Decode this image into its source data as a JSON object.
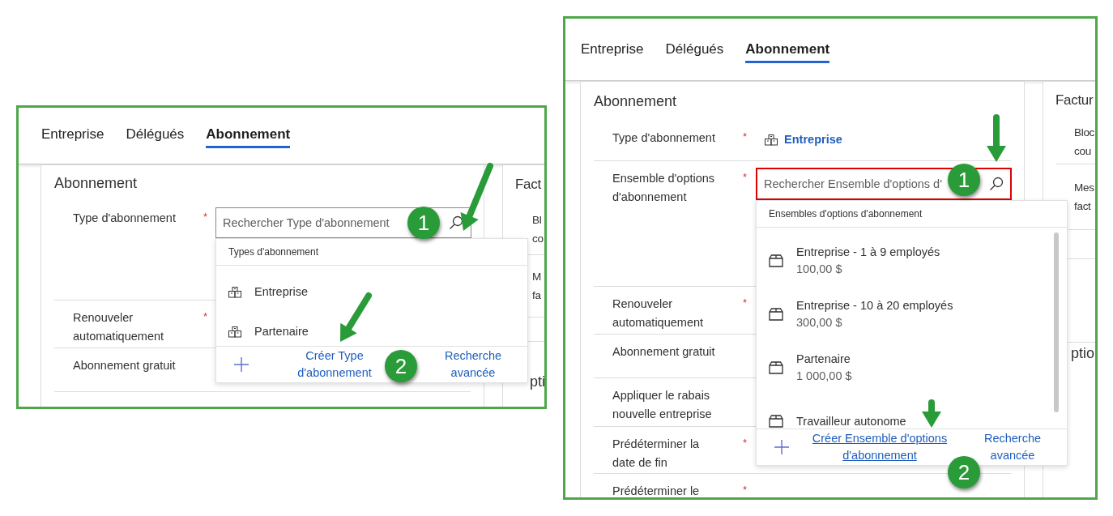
{
  "left_screenshot": {
    "tabs": [
      {
        "label": "Entreprise",
        "selected": false
      },
      {
        "label": "Délégués",
        "selected": false
      },
      {
        "label": "Abonnement",
        "selected": true
      }
    ],
    "form": {
      "title": "Abonnement",
      "fields": [
        {
          "label": "Type d'abonnement",
          "required_mark": "*"
        },
        {
          "label": "Renouveler automatiquement",
          "required_mark": "*"
        },
        {
          "label": "Abonnement gratuit"
        }
      ]
    },
    "side_section": {
      "title": "Fact",
      "rows": [
        [
          "Bl",
          "co"
        ],
        [
          "M",
          "fa"
        ]
      ],
      "next_title": "pti"
    },
    "lookup": {
      "placeholder": "Rechercher Type d'abonnement",
      "focused": false,
      "header": "Types d'abonnement",
      "items": [
        {
          "kind": "boxes",
          "name": "Entreprise"
        },
        {
          "kind": "boxes",
          "name": "Partenaire"
        }
      ],
      "create_link": {
        "text": "Créer Type d'abonnement",
        "hovered": false
      },
      "advanced_link": "Recherche avancée"
    },
    "callouts": [
      "1",
      "2"
    ]
  },
  "right_screenshot": {
    "tabs": [
      {
        "label": "Entreprise",
        "selected": false
      },
      {
        "label": "Délégués",
        "selected": false
      },
      {
        "label": "Abonnement",
        "selected": true
      }
    ],
    "form": {
      "title": "Abonnement",
      "fields": [
        {
          "label": "Type d'abonnement",
          "required_mark": "*",
          "value": "Entreprise"
        },
        {
          "label": "Ensemble d'options d'abonnement",
          "required_mark": "*"
        },
        {
          "label": "Renouveler automatiquement",
          "required_mark": "*"
        },
        {
          "label": "Abonnement gratuit"
        },
        {
          "label": "Appliquer le rabais nouvelle entreprise"
        },
        {
          "label": "Prédéterminer la date de fin",
          "required_mark": "*"
        },
        {
          "label": "Prédéterminer le",
          "required_mark": "*"
        }
      ]
    },
    "side_section": {
      "title": "Factur",
      "rows": [
        [
          "Bloc",
          "cou"
        ],
        [
          "Mes",
          "fact"
        ]
      ],
      "next_title": "ptio"
    },
    "lookup": {
      "placeholder": "Rechercher Ensemble d'options d'",
      "focused": true,
      "header": "Ensembles d'options d'abonnement",
      "items": [
        {
          "kind": "package",
          "name": "Entreprise - 1 à 9 employés",
          "price": "100,00 $"
        },
        {
          "kind": "package",
          "name": "Entreprise - 10 à 20 employés",
          "price": "300,00 $"
        },
        {
          "kind": "package",
          "name": "Partenaire",
          "price": "1 000,00 $"
        },
        {
          "kind": "package",
          "name": "Travailleur autonome"
        }
      ],
      "create_link": {
        "text": "Créer Ensemble d'options d'abonnement",
        "hovered": true
      },
      "advanced_link": "Recherche avancée"
    },
    "callouts": [
      "1",
      "2"
    ]
  }
}
